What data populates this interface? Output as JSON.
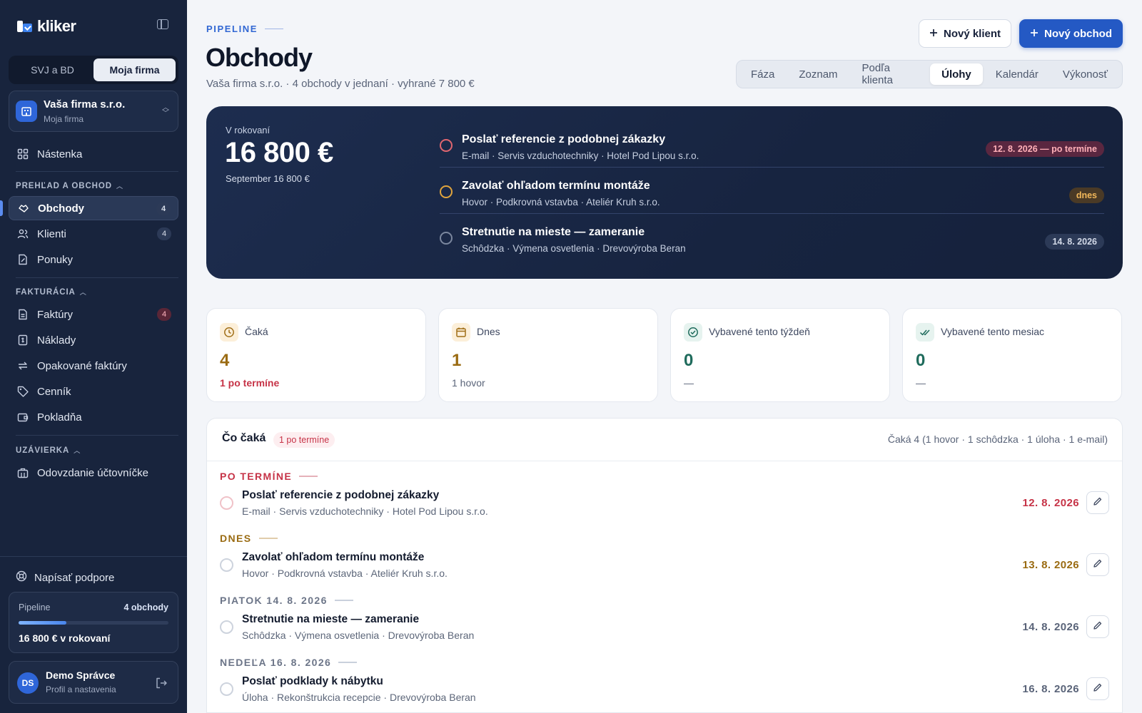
{
  "brand": {
    "name": "kliker"
  },
  "sidebar": {
    "segments": [
      "SVJ a BD",
      "Moja firma"
    ],
    "company": {
      "name": "Vaša firma s.r.o.",
      "sub": "Moja firma"
    },
    "dashboard": "Nástenka",
    "section1": "PREHĽAD A OBCHOD",
    "section1_items": [
      {
        "label": "Obchody",
        "badge": "4",
        "icon": "handshake-icon"
      },
      {
        "label": "Klienti",
        "badge": "4",
        "icon": "users-icon"
      },
      {
        "label": "Ponuky",
        "badge": "",
        "icon": "document-edit-icon"
      }
    ],
    "section2": "FAKTURÁCIA",
    "section2_items": [
      {
        "label": "Faktúry",
        "badge": "4",
        "icon": "invoice-icon"
      },
      {
        "label": "Náklady",
        "badge": "",
        "icon": "receipt-icon"
      },
      {
        "label": "Opakované faktúry",
        "badge": "",
        "icon": "repeat-icon"
      },
      {
        "label": "Cenník",
        "badge": "",
        "icon": "tag-icon"
      },
      {
        "label": "Pokladňa",
        "badge": "",
        "icon": "wallet-icon"
      }
    ],
    "section3": "UZÁVIERKA",
    "section3_items": [
      {
        "label": "Odovzdanie účtovníčke",
        "icon": "briefcase-icon"
      }
    ],
    "support": "Napísať podpore",
    "pipeline": {
      "label": "Pipeline",
      "count": "4 obchody",
      "progress": 0.32,
      "total": "16 800 € v rokovaní"
    },
    "user": {
      "initials": "DS",
      "name": "Demo Správce",
      "sub": "Profil a nastavenia"
    }
  },
  "header": {
    "eyebrow": "PIPELINE",
    "title": "Obchody",
    "subtitle": "Vaša firma s.r.o. · 4 obchody v jednaní · vyhrané 7 800 €",
    "btn_client": "Nový klient",
    "btn_deal": "Nový obchod",
    "tabs": [
      "Fáza",
      "Zoznam",
      "Podľa klienta",
      "Úlohy",
      "Kalendár",
      "Výkonosť"
    ],
    "active_tab": "Úlohy"
  },
  "hero": {
    "label": "V rokovaní",
    "amount": "16 800 €",
    "sub": "September 16 800 €",
    "tasks": [
      {
        "title": "Poslať referencie z podobnej zákazky",
        "meta": "E-mail · Servis vzduchotechniky · Hotel Pod Lipou s.r.o.",
        "pill": "12. 8. 2026 — po termíne",
        "state": "overdue"
      },
      {
        "title": "Zavolať ohľadom termínu montáže",
        "meta": "Hovor · Podkrovná vstavba · Ateliér Kruh s.r.o.",
        "pill": "dnes",
        "state": "today"
      },
      {
        "title": "Stretnutie na mieste — zameranie",
        "meta": "Schôdzka · Výmena osvetlenia · Drevovýroba Beran",
        "pill": "14. 8. 2026",
        "state": "future"
      }
    ]
  },
  "stats": [
    {
      "label": "Čaká",
      "value": "4",
      "sub": "1 po termíne",
      "icon": "clock-icon"
    },
    {
      "label": "Dnes",
      "value": "1",
      "sub": "1 hovor",
      "icon": "calendar-icon"
    },
    {
      "label": "Vybavené tento týždeň",
      "value": "0",
      "sub": "—",
      "icon": "check-circle-icon"
    },
    {
      "label": "Vybavené tento mesiac",
      "value": "0",
      "sub": "—",
      "icon": "double-check-icon"
    }
  ],
  "tasks_list": {
    "title": "Čo čaká",
    "pill": "1 po termíne",
    "summary": "Čaká 4 (1 hovor · 1 schôdzka · 1 úloha · 1 e-mail)",
    "groups": [
      {
        "head": "PO TERMÍNE",
        "title": "Poslať referencie z podobnej zákazky",
        "meta": "E-mail · Servis vzduchotechniky · Hotel Pod Lipou s.r.o.",
        "date": "12. 8. 2026"
      },
      {
        "head": "DNES",
        "title": "Zavolať ohľadom termínu montáže",
        "meta": "Hovor · Podkrovná vstavba · Ateliér Kruh s.r.o.",
        "date": "13. 8. 2026"
      },
      {
        "head": "PIATOK 14. 8. 2026",
        "title": "Stretnutie na mieste — zameranie",
        "meta": "Schôdzka · Výmena osvetlenia · Drevovýroba Beran",
        "date": "14. 8. 2026"
      },
      {
        "head": "NEDEĽA 16. 8. 2026",
        "title": "Poslať podklady k nábytku",
        "meta": "Úloha · Rekonštrukcia recepcie · Drevovýroba Beran",
        "date": "16. 8. 2026"
      }
    ]
  },
  "colors": {
    "accent": "#2459c4",
    "overdue": "#c63347",
    "today": "#9a6b12",
    "success": "#1f6b5c",
    "sidebar_bg": "#18243d"
  }
}
